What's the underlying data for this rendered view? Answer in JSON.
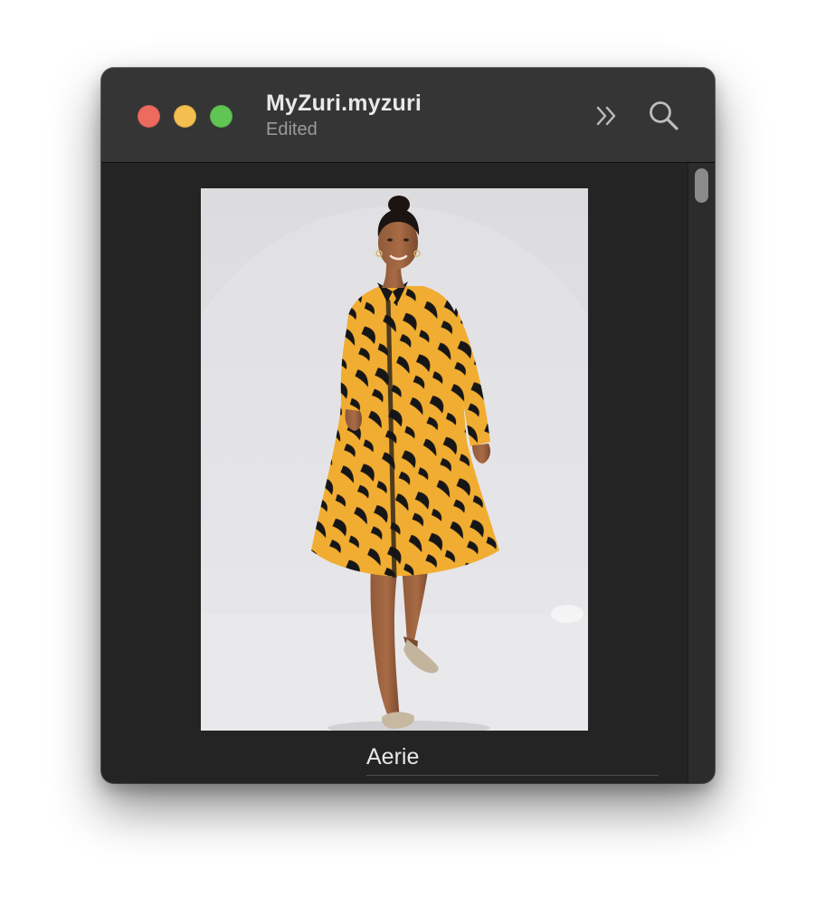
{
  "window": {
    "title": "MyZuri.myzuri",
    "subtitle": "Edited"
  },
  "toolbar": {
    "overflow_icon": "chevron-double-right-icon",
    "search_icon": "search-icon"
  },
  "traffic_lights": {
    "close": "#ed6a5e",
    "minimize": "#f4bf4f",
    "maximize": "#61c554"
  },
  "content": {
    "item_label": "Aerie",
    "dress_color": "#f1ad31",
    "print_color": "#171617"
  }
}
